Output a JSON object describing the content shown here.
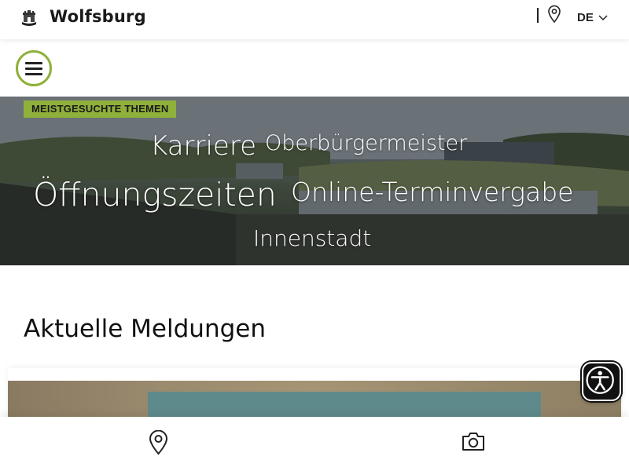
{
  "header": {
    "brand": "Wolfsburg",
    "language": "DE",
    "icons": {
      "logo": "wolfsburg-crest-icon",
      "location": "location-pin-icon",
      "language_menu": "chevron-down-icon"
    }
  },
  "menu": {
    "icon": "hamburger-menu-icon"
  },
  "hero": {
    "badge": "MEISTGESUCHTE THEMEN",
    "topics": [
      "Karriere",
      "Oberbürgermeister",
      "Öffnungszeiten",
      "Online-Terminvergabe",
      "Innenstadt"
    ]
  },
  "news": {
    "title": "Aktuelle Meldungen"
  },
  "accessibility": {
    "icon": "accessibility-person-icon"
  },
  "bottom_nav": {
    "icons": [
      "location-pin-icon",
      "camera-icon"
    ]
  },
  "colors": {
    "accent": "#8fb03a",
    "text": "#111111",
    "background": "#ffffff"
  }
}
